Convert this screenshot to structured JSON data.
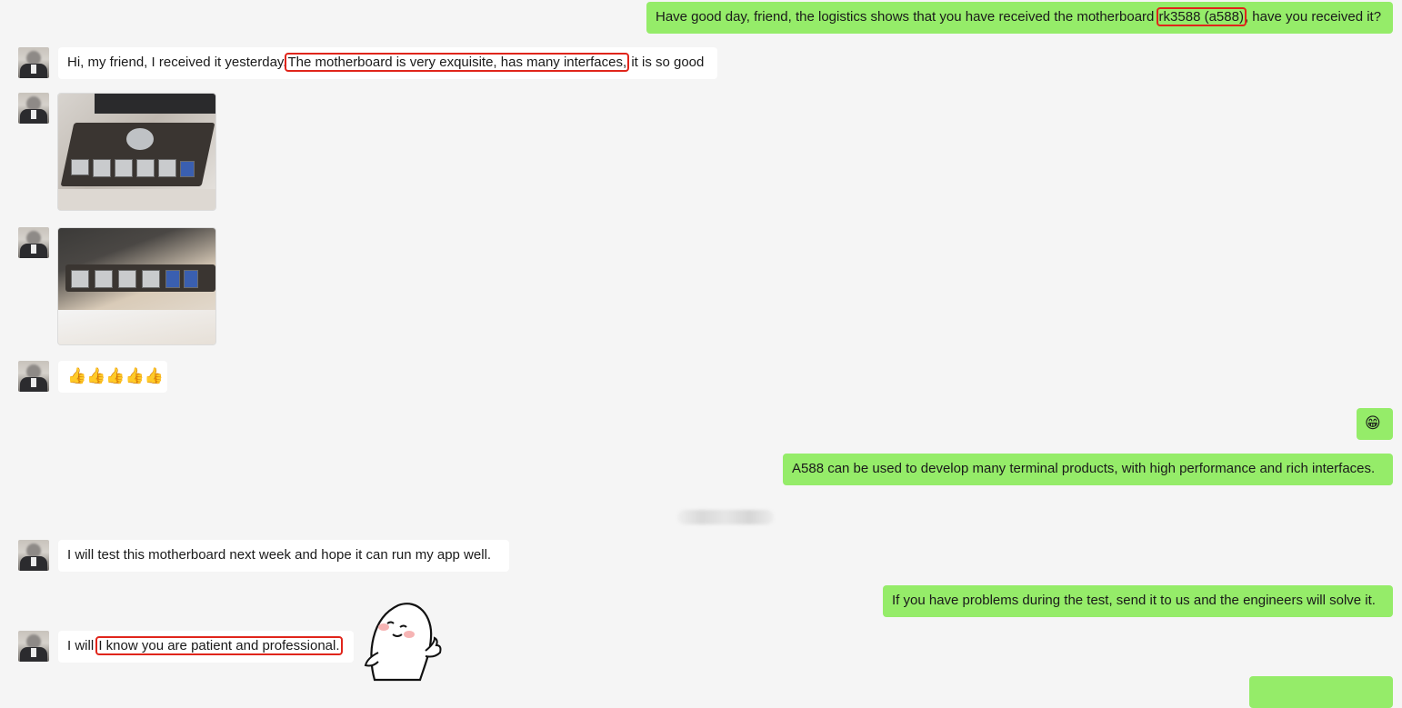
{
  "chat": {
    "messages": [
      {
        "side": "out",
        "text_before": "Have good day, friend, the logistics shows that you have received the motherboard ",
        "highlight": "rk3588 (a588)",
        "text_after": ", have you received it?"
      },
      {
        "side": "in",
        "text_before": "Hi, my friend, I received it yesterday.",
        "highlight": "The motherboard is very exquisite, has many interfaces,",
        "text_after": " it is so good"
      },
      {
        "side": "in",
        "type": "image",
        "image_desc": "motherboard-photo-top"
      },
      {
        "side": "in",
        "type": "image",
        "image_desc": "motherboard-photo-side"
      },
      {
        "side": "in",
        "type": "emoji",
        "text": "👍👍👍👍👍"
      },
      {
        "side": "out",
        "type": "emoji",
        "text": "😁"
      },
      {
        "side": "out",
        "text": "A588 can be used to develop many terminal products, with high performance and rich interfaces."
      },
      {
        "side": "in",
        "text": "I will test this motherboard next week and hope it can run my app well."
      },
      {
        "side": "out",
        "text": "If you have problems during the test, send it to us and the engineers will solve it."
      },
      {
        "side": "in",
        "text_before": "I will ",
        "highlight": "I know you are patient and professional.",
        "text_after": ""
      }
    ]
  },
  "colors": {
    "background": "#f5f5f5",
    "incoming_bubble": "#ffffff",
    "outgoing_bubble": "#95ec69",
    "highlight_box": "#e0251b"
  },
  "icons": {
    "avatar": "contact-avatar",
    "sticker": "cartoon-ghost-sticker"
  }
}
